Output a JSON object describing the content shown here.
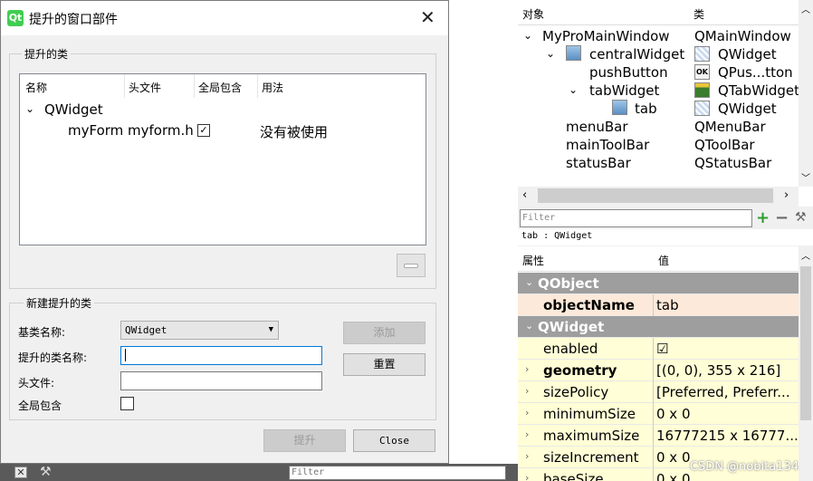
{
  "dialog": {
    "title": "提升的窗口部件",
    "logo_text": "Qt",
    "close_glyph": "✕",
    "promoted_group_label": "提升的类",
    "table": {
      "headers": [
        "名称",
        "头文件",
        "全局包含",
        "用法"
      ],
      "parent": "QWidget",
      "child": {
        "name": "myForm",
        "header": "myform.h",
        "global_include_checked": true,
        "usage": "没有被使用"
      }
    },
    "new_group_label": "新建提升的类",
    "fields": {
      "base_class_label": "基类名称:",
      "base_class_value": "QWidget",
      "promoted_class_label": "提升的类名称:",
      "header_label": "头文件:",
      "global_include_label": "全局包含"
    },
    "buttons": {
      "add": "添加",
      "reset": "重置",
      "promote": "提升",
      "close": "Close"
    }
  },
  "bottom_strip": {
    "filter_placeholder": "Filter"
  },
  "object_inspector": {
    "headers": [
      "对象",
      "类"
    ],
    "rows": [
      {
        "name": "MyProMainWindow",
        "class": "QMainWindow",
        "expanded": true
      },
      {
        "name": "centralWidget",
        "class": "QWidget",
        "expanded": true
      },
      {
        "name": "pushButton",
        "class": "QPus...tton"
      },
      {
        "name": "tabWidget",
        "class": "QTabWidget",
        "expanded": true
      },
      {
        "name": "tab",
        "class": "QWidget"
      },
      {
        "name": "menuBar",
        "class": "QMenuBar"
      },
      {
        "name": "mainToolBar",
        "class": "QToolBar"
      },
      {
        "name": "statusBar",
        "class": "QStatusBar"
      }
    ]
  },
  "filter_bar": {
    "placeholder": "Filter"
  },
  "crumb": "tab : QWidget",
  "property_editor": {
    "headers": [
      "属性",
      "值"
    ],
    "rows": [
      {
        "type": "section",
        "name": "QObject"
      },
      {
        "type": "prop",
        "name": "objectName",
        "value": "tab",
        "bold": true,
        "color": "#fde9d9"
      },
      {
        "type": "section",
        "name": "QWidget"
      },
      {
        "type": "prop",
        "name": "enabled",
        "value": "☑",
        "color": "#fffed6"
      },
      {
        "type": "prop",
        "name": "geometry",
        "value": "[(0, 0), 355 x 216]",
        "bold": true,
        "expandable": true,
        "color": "#fffed6"
      },
      {
        "type": "prop",
        "name": "sizePolicy",
        "value": "[Preferred, Preferr...",
        "expandable": true,
        "color": "#fffed6"
      },
      {
        "type": "prop",
        "name": "minimumSize",
        "value": "0 x 0",
        "expandable": true,
        "color": "#fffed6"
      },
      {
        "type": "prop",
        "name": "maximumSize",
        "value": "16777215 x 16777...",
        "expandable": true,
        "color": "#fffed6"
      },
      {
        "type": "prop",
        "name": "sizeIncrement",
        "value": "0 x 0",
        "expandable": true,
        "color": "#fffed6"
      },
      {
        "type": "prop",
        "name": "baseSize",
        "value": "0 x 0",
        "expandable": true,
        "color": "#fffed6"
      }
    ]
  },
  "watermark": "CSDN @nobita134"
}
